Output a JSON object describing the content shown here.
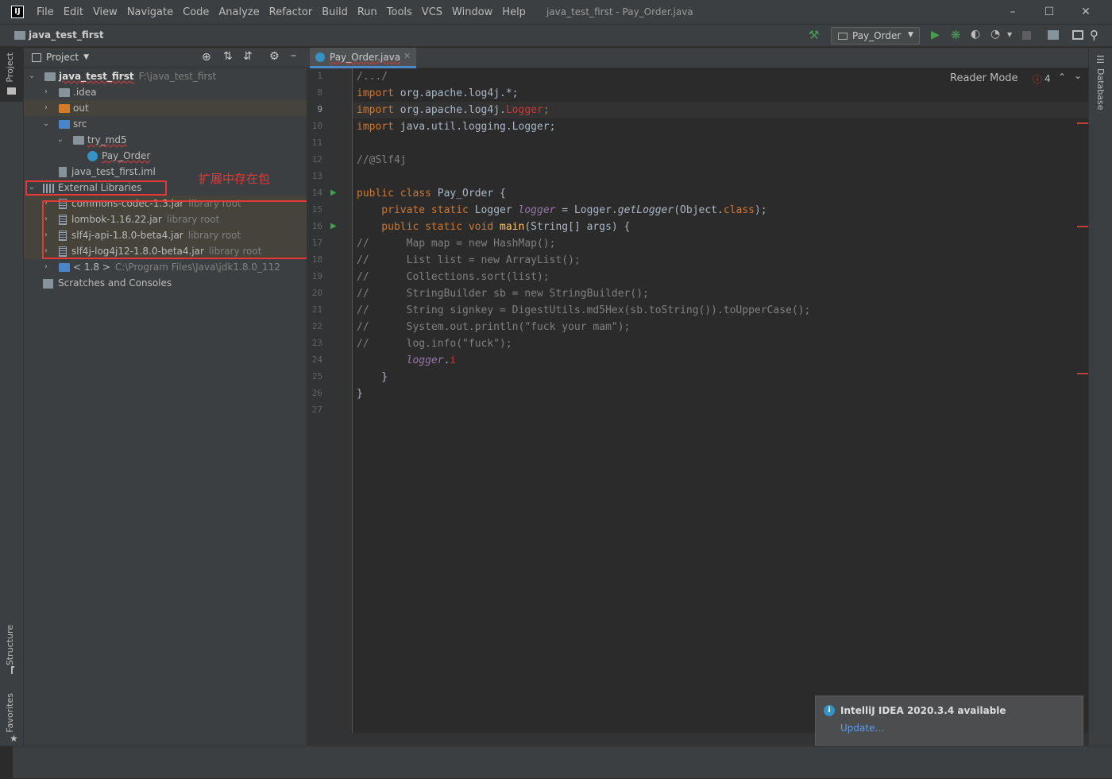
{
  "menubar": {
    "items": [
      "File",
      "Edit",
      "View",
      "Navigate",
      "Code",
      "Analyze",
      "Refactor",
      "Build",
      "Run",
      "Tools",
      "VCS",
      "Window",
      "Help"
    ],
    "window_title": "java_test_first - Pay_Order.java"
  },
  "navbar": {
    "project": "java_test_first",
    "run_config": "Pay_Order"
  },
  "left_tabs": {
    "project": "Project",
    "structure": "Structure",
    "favorites": "Favorites"
  },
  "right_tabs": {
    "database": "Database"
  },
  "project_panel": {
    "title": "Project",
    "tree": [
      {
        "label": "java_test_first",
        "hint": "F:\\java_test_first"
      },
      {
        "label": ".idea"
      },
      {
        "label": "out"
      },
      {
        "label": "src"
      },
      {
        "label": "try_md5"
      },
      {
        "label": "Pay_Order"
      },
      {
        "label": "java_test_first.iml"
      },
      {
        "label": "External Libraries"
      },
      {
        "label": "commons-codec-1.3.jar",
        "hint": "library root"
      },
      {
        "label": "lombok-1.16.22.jar",
        "hint": "library root"
      },
      {
        "label": "slf4j-api-1.8.0-beta4.jar",
        "hint": "library root"
      },
      {
        "label": "slf4j-log4j12-1.8.0-beta4.jar",
        "hint": "library root"
      },
      {
        "label": "< 1.8 >",
        "hint": "C:\\Program Files\\Java\\jdk1.8.0_112"
      },
      {
        "label": "Scratches and Consoles"
      }
    ],
    "annotation": "扩展中存在包"
  },
  "editor": {
    "tab": "Pay_Order.java",
    "reader_mode": "Reader Mode",
    "error_count": "4",
    "line_numbers": [
      "1",
      "8",
      "9",
      "10",
      "11",
      "12",
      "13",
      "14",
      "15",
      "16",
      "17",
      "18",
      "19",
      "20",
      "21",
      "22",
      "23",
      "24",
      "25",
      "26",
      "27"
    ],
    "lines": {
      "l1": "/.../",
      "l8a": "import",
      "l8b": " org.apache.log4j.*;",
      "l9a": "import",
      "l9b": " org.apache.log4j.",
      "l9c": "Logger",
      "l9d": ";",
      "l10a": "import",
      "l10b": " java.util.logging.Logger;",
      "l12": "//@Slf4j",
      "l14a": "public class",
      "l14b": " Pay_Order {",
      "l15a": "    private static",
      "l15b": " Logger ",
      "l15c": "logger",
      "l15d": " = Logger.",
      "l15e": "getLogger",
      "l15f": "(Object.",
      "l15g": "class",
      "l15h": ");",
      "l16a": "    public static void",
      "l16b": " main",
      "l16c": "(String[] args) {",
      "l17": "//      Map map = new HashMap();",
      "l18": "//      List list = new ArrayList();",
      "l19": "//      Collections.sort(list);",
      "l20": "//      StringBuilder sb = new StringBuilder();",
      "l21": "//      String signkey = DigestUtils.md5Hex(sb.toString()).toUpperCase();",
      "l22": "//      System.out.println(\"fuck your mam\");",
      "l23": "//      log.info(\"fuck\");",
      "l24a": "        logger",
      "l24b": ".",
      "l24c": "i",
      "l25": "    }",
      "l26": "}"
    }
  },
  "notification": {
    "title": "IntelliJ IDEA 2020.3.4 available",
    "link": "Update..."
  },
  "colors": {
    "accent": "#589df6",
    "error": "#e53935",
    "run": "#499c54"
  }
}
